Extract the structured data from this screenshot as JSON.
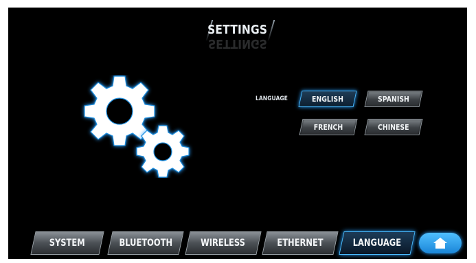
{
  "header": {
    "title": "SETTINGS"
  },
  "icons": {
    "main": "gears-icon",
    "home": "home-icon"
  },
  "colors": {
    "accent": "#2aa0ff",
    "background": "#000000",
    "button": "#4b5055"
  },
  "language_panel": {
    "label": "LANGUAGE",
    "selected": "ENGLISH",
    "options": [
      "ENGLISH",
      "SPANISH",
      "FRENCH",
      "CHINESE"
    ]
  },
  "tabs": [
    {
      "label": "SYSTEM",
      "active": false
    },
    {
      "label": "BLUETOOTH",
      "active": false
    },
    {
      "label": "WIRELESS",
      "active": false
    },
    {
      "label": "ETHERNET",
      "active": false
    },
    {
      "label": "LANGUAGE",
      "active": true
    }
  ]
}
